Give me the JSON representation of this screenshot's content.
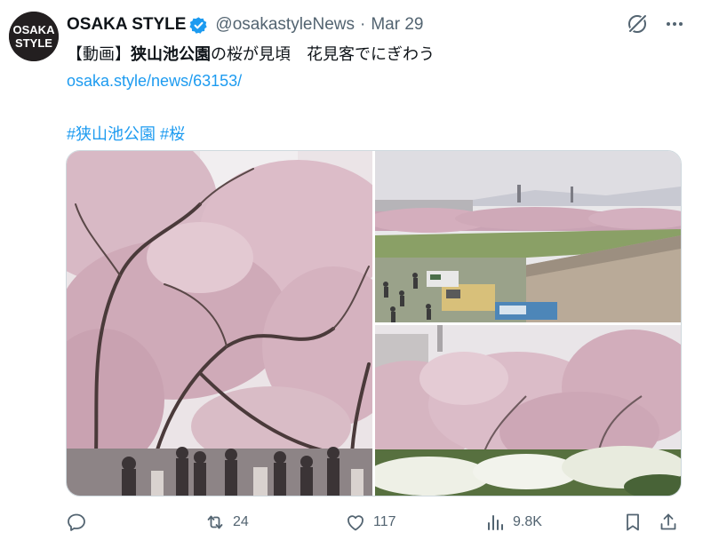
{
  "account": {
    "avatar_text_top": "OSAKA",
    "avatar_text_bottom": "STYLE",
    "display_name": "OSAKA STYLE",
    "handle": "@osakastyleNews",
    "separator": "·",
    "date": "Mar 29"
  },
  "tweet": {
    "line1_prefix": "【動画】",
    "line1_bold": "狭山池公園",
    "line1_suffix": "の桜が見頃　花見客でにぎわう",
    "link": "osaka.style/news/63153/",
    "hashtag1": "#狭山池公園",
    "hashtag2": "#桜"
  },
  "media": {
    "photo1": "cherry-blossom-tree-tunnel-photo",
    "photo2": "riverbank-food-trucks-photo",
    "photo3": "blossoms-over-white-flowers-photo"
  },
  "actions": {
    "reply_count": "",
    "retweet_count": "24",
    "like_count": "117",
    "view_count": "9.8K"
  },
  "icons": [
    "verified-badge-icon",
    "grok-icon",
    "more-icon",
    "reply-icon",
    "retweet-icon",
    "like-icon",
    "views-icon",
    "bookmark-icon",
    "share-icon"
  ],
  "colors": {
    "accent": "#1d9bf0",
    "secondary_text": "#536471",
    "primary_text": "#0f1419"
  }
}
